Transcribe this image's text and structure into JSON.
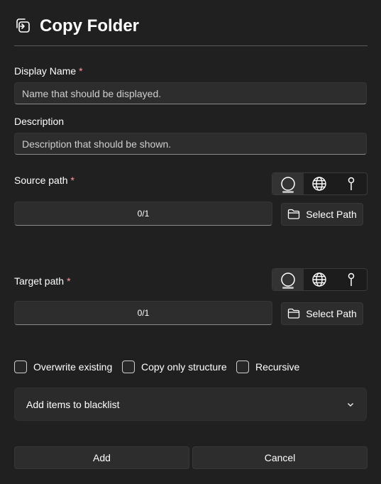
{
  "header": {
    "title": "Copy Folder"
  },
  "display_name": {
    "label": "Display Name",
    "required_mark": "*",
    "placeholder": "Name that should be displayed."
  },
  "description": {
    "label": "Description",
    "placeholder": "Description that should be shown."
  },
  "source_path": {
    "label": "Source path",
    "required_mark": "*",
    "value": "0/1",
    "button_label": "Select Path"
  },
  "target_path": {
    "label": "Target path",
    "required_mark": "*",
    "value": "0/1",
    "button_label": "Select Path"
  },
  "path_modes": [
    "circle-icon",
    "globe-icon",
    "pin-icon"
  ],
  "options": [
    {
      "label": "Overwrite existing",
      "checked": false
    },
    {
      "label": "Copy only structure",
      "checked": false
    },
    {
      "label": "Recursive",
      "checked": false
    }
  ],
  "blacklist": {
    "label": "Add items to blacklist"
  },
  "footer": {
    "add_label": "Add",
    "cancel_label": "Cancel"
  },
  "colors": {
    "background": "#202020",
    "required": "#ff99a4",
    "control": "#2d2d2d"
  }
}
